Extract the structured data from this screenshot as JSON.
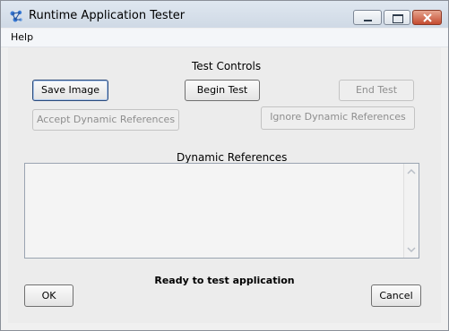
{
  "window": {
    "title": "Runtime Application Tester"
  },
  "menu": {
    "items": [
      "Help"
    ]
  },
  "controls": {
    "heading": "Test Controls",
    "save_image": "Save Image",
    "begin_test": "Begin Test",
    "end_test": "End Test",
    "accept_dynamic": "Accept Dynamic References",
    "ignore_dynamic": "Ignore Dynamic References"
  },
  "dynamic_refs": {
    "heading": "Dynamic References"
  },
  "status": {
    "text": "Ready to test application"
  },
  "footer": {
    "ok": "OK",
    "cancel": "Cancel"
  },
  "colors": {
    "window_bg": "#f0f0f0",
    "titlebar": "#dfe7f0",
    "close_button": "#c54b30",
    "disabled_text": "#8e8e8e"
  }
}
